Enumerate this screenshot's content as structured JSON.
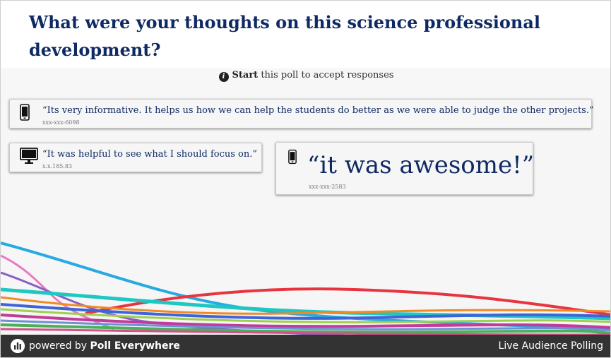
{
  "poll": {
    "title": "What were your thoughts on this science professional development?",
    "status_action": "Start",
    "status_text": "this poll to accept responses",
    "info_icon": "info-icon"
  },
  "responses": [
    {
      "device_icon": "mobile-phone-icon",
      "text": "“Its very informative. It helps us how we can help the students do better as we were able to judge the other projects.”",
      "source": "xxx-xxx-6098"
    },
    {
      "device_icon": "desktop-monitor-icon",
      "text": "“It was helpful to see what I should focus on.”",
      "source": "x.x.185.83"
    },
    {
      "device_icon": "mobile-phone-icon",
      "text": "“it was awesome!”",
      "source": "xxx-xxx-2583"
    }
  ],
  "footer": {
    "powered_prefix": "powered by",
    "brand": "Poll Everywhere",
    "tagline": "Live Audience Polling",
    "logo_icon": "poll-everywhere-logo-icon"
  },
  "colors": {
    "title": "#0f2a63",
    "footer_bg": "#333333",
    "card_bg": "#f6f6f6"
  }
}
